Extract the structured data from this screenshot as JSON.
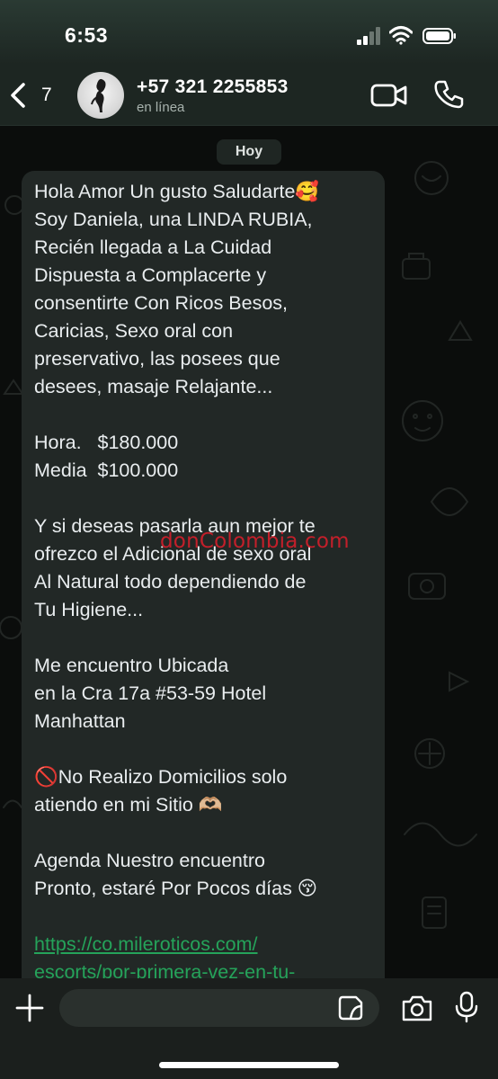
{
  "status_bar": {
    "time": "6:53"
  },
  "header": {
    "back_count": "7",
    "contact_name": "+57 321 2255853",
    "contact_status": "en línea"
  },
  "chat": {
    "date_label": "Hoy",
    "message_lines": [
      "Hola Amor Un gusto Saludarte🥰",
      "Soy Daniela, una LINDA RUBIA,",
      "Recién llegada a La Cuidad",
      "Dispuesta a Complacerte y",
      "consentirte Con Ricos Besos,",
      "Caricias, Sexo oral con",
      "preservativo, las posees que",
      "desees, masaje Relajante...",
      "",
      "Hora.   $180.000",
      "Media  $100.000",
      "",
      "Y si deseas pasarla aun mejor te",
      "ofrezco el Adicional de sexo oral",
      "Al Natural todo dependiendo de",
      "Tu Higiene...",
      "",
      "Me encuentro Ubicada",
      "en la Cra 17a #53-59 Hotel",
      "Manhattan",
      "",
      "🚫No Realizo Domicilios solo",
      "atiendo en mi Sitio 🫶🏼",
      "",
      "Agenda Nuestro encuentro",
      "Pronto, estaré Por Pocos días 😚",
      ""
    ],
    "link_lines": [
      "https://co.mileroticos.com/",
      "escorts/por-primera-vez-en-tu-"
    ],
    "watermark": "donColombia.com"
  },
  "composer": {
    "input_value": "",
    "input_placeholder": ""
  },
  "colors": {
    "header_bg": "#1d2622",
    "bubble_bg": "#222826",
    "link": "#25a35a",
    "watermark": "#d11f2b"
  },
  "icons": {
    "back": "chevron-left-icon",
    "video": "video-camera-icon",
    "phone": "phone-icon",
    "plus": "plus-icon",
    "sticker": "sticker-icon",
    "camera": "camera-icon",
    "mic": "microphone-icon"
  }
}
